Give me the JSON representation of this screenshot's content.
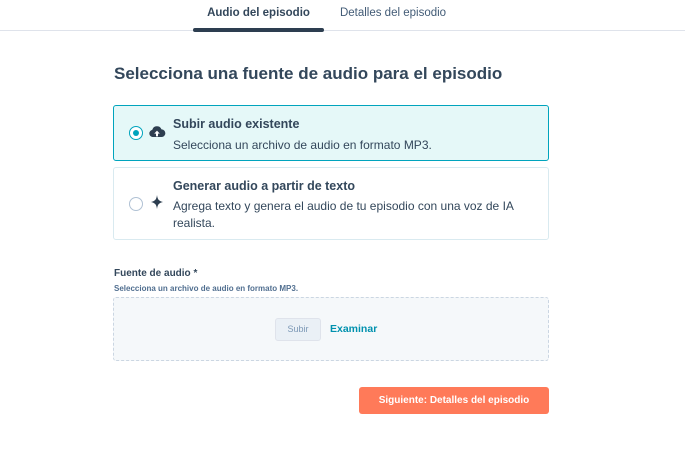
{
  "tabs": [
    {
      "label": "Audio del episodio",
      "active": true
    },
    {
      "label": "Detalles del episodio",
      "active": false
    }
  ],
  "page_title": "Selecciona una fuente de audio para el episodio",
  "options": [
    {
      "title": "Subir audio existente",
      "description": "Selecciona un archivo de audio en formato MP3.",
      "icon": "cloud-upload-icon",
      "selected": true
    },
    {
      "title": "Generar audio a partir de texto",
      "description": "Agrega texto y genera el audio de tu episodio con una voz de IA realista.",
      "icon": "sparkle-icon",
      "selected": false
    }
  ],
  "audio_source": {
    "label": "Fuente de audio *",
    "help": "Selecciona un archivo de audio en formato MP3.",
    "upload_button": "Subir",
    "browse_link": "Examinar"
  },
  "next_button": "Siguiente: Detalles del episodio",
  "colors": {
    "accent": "#00a4bd",
    "primary_button": "#ff7a59",
    "link": "#0091ae",
    "text": "#33475b"
  }
}
